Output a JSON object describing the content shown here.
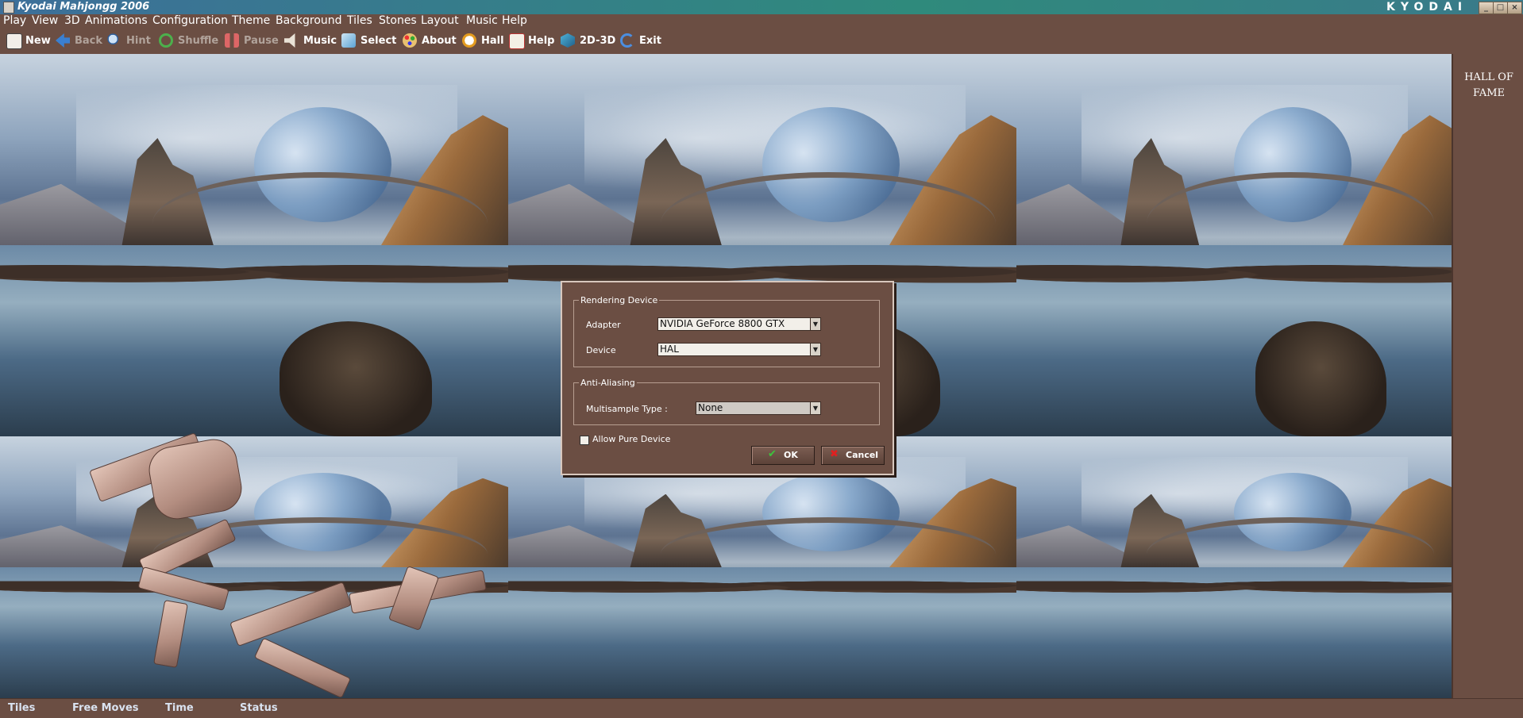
{
  "window": {
    "title": "Kyodai Mahjongg 2006",
    "brand": "KYODAI",
    "controls": {
      "minimize": "_",
      "maximize": "□",
      "close": "×"
    }
  },
  "menu": [
    "Play",
    "View",
    "3D",
    "Animations",
    "Configuration",
    "Theme",
    "Background",
    "Tiles",
    "Stones",
    "Layout",
    "Music",
    "Help"
  ],
  "toolbar": [
    {
      "label": "New",
      "icon": "dice-icon",
      "enabled": true
    },
    {
      "label": "Back",
      "icon": "back-arrow-icon",
      "enabled": false
    },
    {
      "label": "Hint",
      "icon": "magnifier-icon",
      "enabled": false
    },
    {
      "label": "Shuffle",
      "icon": "shuffle-icon",
      "enabled": false
    },
    {
      "label": "Pause",
      "icon": "pause-icon",
      "enabled": false
    },
    {
      "label": "Music",
      "icon": "speaker-icon",
      "enabled": true
    },
    {
      "label": "Select",
      "icon": "select-icon",
      "enabled": true
    },
    {
      "label": "About",
      "icon": "palette-icon",
      "enabled": true
    },
    {
      "label": "Hall",
      "icon": "clock-icon",
      "enabled": true
    },
    {
      "label": "Help",
      "icon": "book-icon",
      "enabled": true
    },
    {
      "label": "2D-3D",
      "icon": "cube-icon",
      "enabled": true
    },
    {
      "label": "Exit",
      "icon": "exit-icon",
      "enabled": true
    }
  ],
  "hall": {
    "line1": "HALL OF",
    "line2": "FAME"
  },
  "dialog": {
    "rendering": {
      "legend": "Rendering Device",
      "adapter_label": "Adapter",
      "adapter_value": "NVIDIA GeForce 8800 GTX",
      "device_label": "Device",
      "device_value": "HAL"
    },
    "antialiasing": {
      "legend": "Anti-Aliasing",
      "multisample_label": "Multisample Type :",
      "multisample_value": "None"
    },
    "pure_device": {
      "label": "Allow Pure Device",
      "checked": false
    },
    "ok_label": "OK",
    "cancel_label": "Cancel"
  },
  "status": {
    "tiles": "Tiles",
    "free_moves": "Free Moves",
    "time": "Time",
    "status": "Status"
  },
  "colors": {
    "panel": "#6b4e43",
    "title_bar": "#2f8a7c",
    "status_text": "#d9e2f0",
    "ok_check": "#3cc43c",
    "cancel_x": "#e02020"
  }
}
